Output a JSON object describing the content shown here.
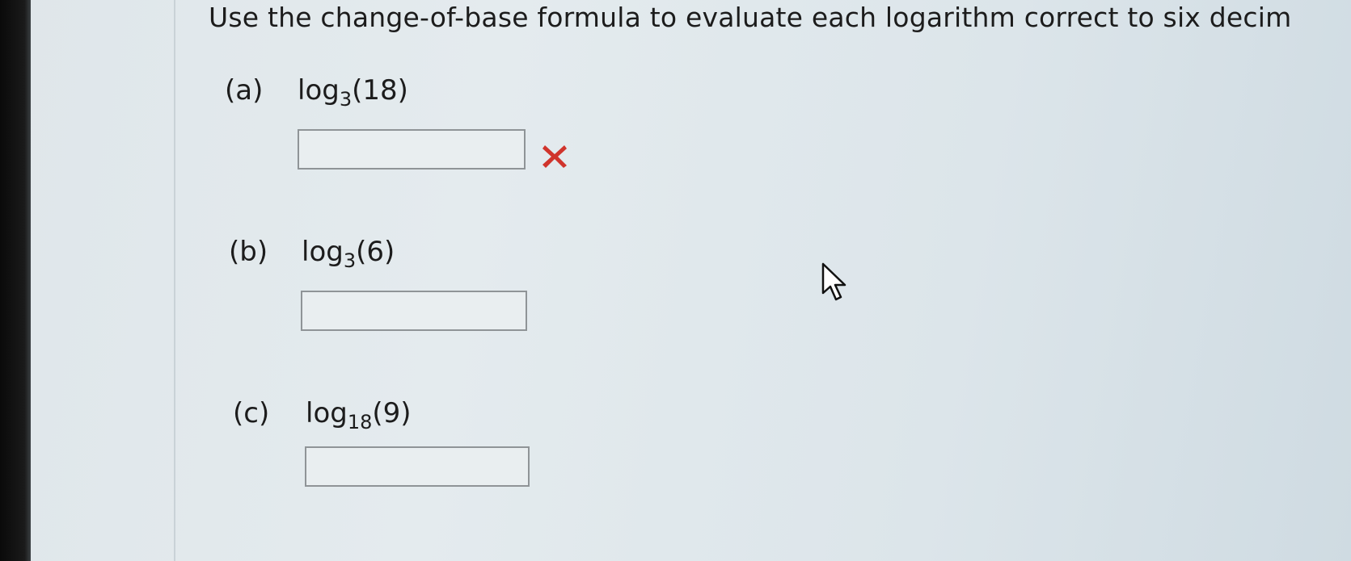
{
  "question": {
    "instruction": "Use the change-of-base formula to evaluate each logarithm correct to six decim"
  },
  "parts": [
    {
      "letter": "(a)",
      "func": "log",
      "base": "3",
      "arg": "(18)",
      "answer_value": "",
      "status": "incorrect"
    },
    {
      "letter": "(b)",
      "func": "log",
      "base": "3",
      "arg": "(6)",
      "answer_value": ""
    },
    {
      "letter": "(c)",
      "func": "log",
      "base": "18",
      "arg": "(9)",
      "answer_value": ""
    }
  ],
  "colors": {
    "incorrect_mark": "#d0342c"
  },
  "icons": {
    "incorrect": "x-mark-icon",
    "pointer": "mouse-cursor-icon"
  }
}
